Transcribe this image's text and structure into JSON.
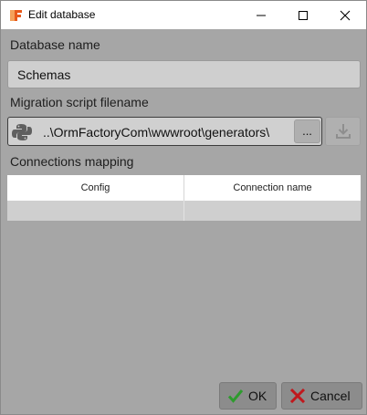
{
  "window": {
    "title": "Edit database",
    "controls": {
      "minimize": "minimize-icon",
      "maximize": "maximize-icon",
      "close": "close-icon"
    }
  },
  "form": {
    "database_name_label": "Database name",
    "database_name_value": "Schemas",
    "migration_label": "Migration script filename",
    "migration_value": "..\\OrmFactoryCom\\wwwroot\\generators\\",
    "browse_label": "...",
    "connections_label": "Connections mapping"
  },
  "table": {
    "columns": [
      "Config",
      "Connection name"
    ],
    "rows": [
      [
        "",
        ""
      ]
    ]
  },
  "buttons": {
    "ok": "OK",
    "cancel": "Cancel"
  },
  "colors": {
    "accent_check": "#2e9b2e",
    "cancel_x": "#c0181d",
    "app_icon": "#e8591a"
  }
}
